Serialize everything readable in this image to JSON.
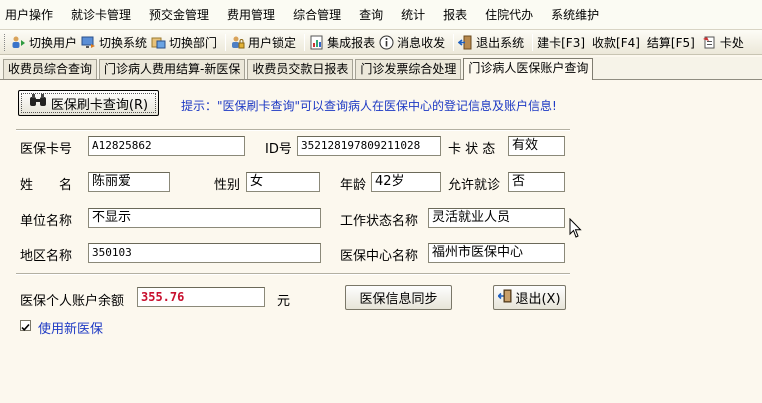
{
  "menu": [
    "用户操作",
    "就诊卡管理",
    "预交金管理",
    "费用管理",
    "综合管理",
    "查询",
    "统计",
    "报表",
    "住院代办",
    "系统维护"
  ],
  "toolbar": {
    "switch_user": "切换用户",
    "switch_system": "切换系统",
    "switch_dept": "切换部门",
    "user_lock": "用户锁定",
    "integrated_report": "集成报表",
    "message": "消息收发",
    "exit_system": "退出系统",
    "build_card": "建卡[F3]",
    "charge": "收款[F4]",
    "settle": "结算[F5]",
    "card_proc": "卡处"
  },
  "tabs": [
    "收费员综合查询",
    "门诊病人费用结算-新医保",
    "收费员交款日报表",
    "门诊发票综合处理",
    "门诊病人医保账户查询"
  ],
  "active_tab": 4,
  "form": {
    "query_button": "医保刷卡查询(R)",
    "hint": "提示：\"医保刷卡查询\"可以查询病人在医保中心的登记信息及账户信息!",
    "card_no_label": "医保卡号",
    "card_no": "A12825862",
    "id_label": "ID号",
    "id": "352128197809211028",
    "card_status_label": "卡 状 态",
    "card_status": "有效",
    "name_label": "姓　　名",
    "name": "陈丽爱",
    "gender_label": "性别",
    "gender": "女",
    "age_label": "年龄",
    "age": "42岁",
    "allow_visit_label": "允许就诊",
    "allow_visit": "否",
    "unit_label": "单位名称",
    "unit": "不显示",
    "work_status_label": "工作状态名称",
    "work_status": "灵活就业人员",
    "region_label": "地区名称",
    "region": "350103",
    "center_label": "医保中心名称",
    "center": "福州市医保中心",
    "balance_label": "医保个人账户余额",
    "balance": "355.76",
    "currency": "元",
    "sync_button": "医保信息同步",
    "exit_button": "退出(X)",
    "use_new_insurance": "使用新医保",
    "use_new_insurance_checked": true
  }
}
